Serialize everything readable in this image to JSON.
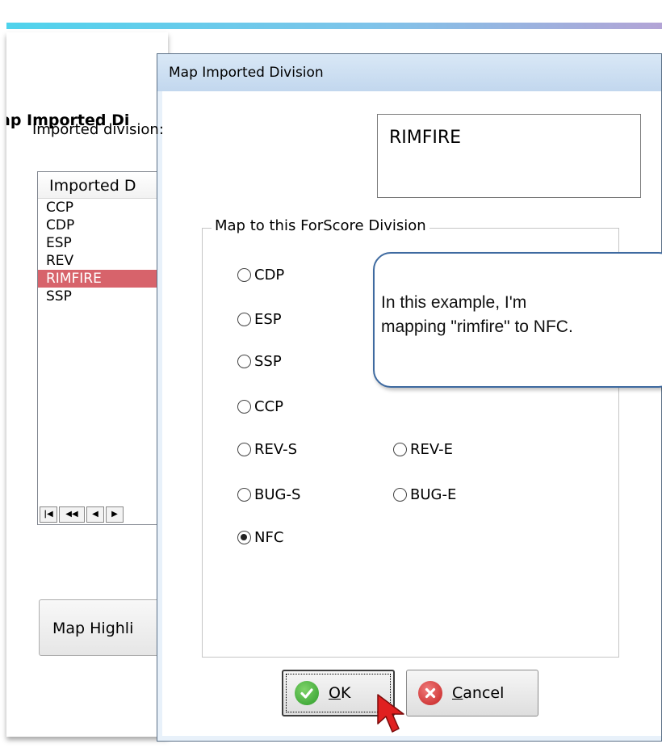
{
  "background_window": {
    "title": "ap Imported Di",
    "list": {
      "header": "Imported D",
      "items": [
        "CCP",
        "CDP",
        "ESP",
        "REV",
        "RIMFIRE",
        "SSP"
      ],
      "selected": "RIMFIRE",
      "nav_buttons": [
        "first",
        "prev-page",
        "prev",
        "next"
      ]
    },
    "button_label": "Map Highli"
  },
  "dialog": {
    "title": "Map Imported Division",
    "imported_label": "Imported division:",
    "imported_value": "RIMFIRE",
    "group_label": "Map to this ForScore Division",
    "options": {
      "cdp": "CDP",
      "esp": "ESP",
      "ssp": "SSP",
      "ccp": "CCP",
      "rev_s": "REV-S",
      "rev_e": "REV-E",
      "bug_s": "BUG-S",
      "bug_e": "BUG-E",
      "nfc": "NFC"
    },
    "selected_option": "NFC",
    "ok_label": "OK",
    "ok_mnemonic": "O",
    "ok_rest": "K",
    "cancel_label": "Cancel",
    "cancel_mnemonic": "C",
    "cancel_rest": "ancel"
  },
  "callout": {
    "line1": "In this example, I'm",
    "line2": "mapping \"rimfire\" to NFC."
  },
  "colors": {
    "selection": "#d7636b",
    "callout_border": "#3e6aa0",
    "dialog_title_bg": "#c2d7ee",
    "cursor_red": "#e02020"
  },
  "icons": [
    "check-circle-icon",
    "x-circle-icon",
    "mouse-cursor-icon",
    "radio-icon"
  ]
}
